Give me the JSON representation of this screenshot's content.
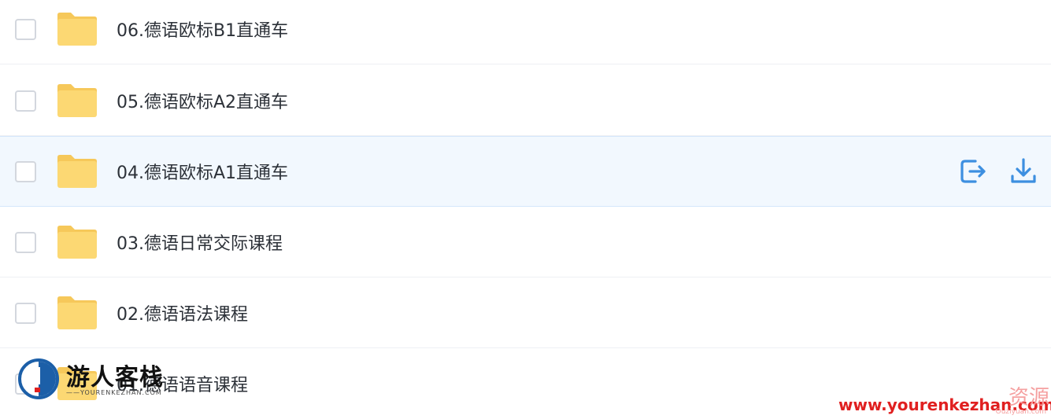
{
  "rows": [
    {
      "name": "06.德语欧标B1直通车"
    },
    {
      "name": "05.德语欧标A2直通车"
    },
    {
      "name": "04.德语欧标A1直通车"
    },
    {
      "name": "03.德语日常交际课程"
    },
    {
      "name": "02.德语语法课程"
    },
    {
      "name": "01.德语语音课程"
    }
  ],
  "hover_row_index": 2,
  "colors": {
    "folder": "#fcd873",
    "folder_tab": "#f6c85a",
    "accent": "#3d8fe0",
    "hover_bg": "#f2f8fe"
  },
  "watermark": {
    "left_title": "游人客栈",
    "left_sub": "——YOURENKEZHAN.COM",
    "right_url": "www.yourenkezhan.com",
    "right_mark": "资源",
    "right_sub": "Ouziyuan.com"
  }
}
